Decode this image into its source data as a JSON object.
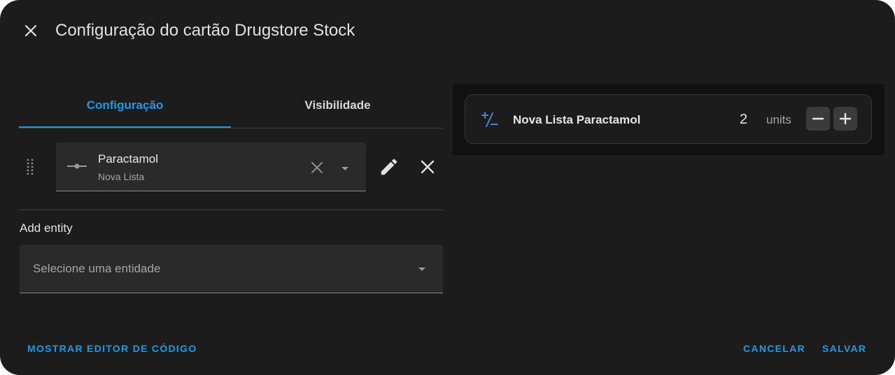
{
  "dialog": {
    "title": "Configuração do cartão Drugstore Stock"
  },
  "tabs": [
    {
      "label": "Configuração",
      "active": true
    },
    {
      "label": "Visibilidade",
      "active": false
    }
  ],
  "entity_row": {
    "name": "Paractamol",
    "secondary": "Nova Lista"
  },
  "add_entity": {
    "label": "Add entity",
    "placeholder": "Selecione uma entidade"
  },
  "preview_card": {
    "name": "Nova Lista Paractamol",
    "value": "2",
    "unit": "units"
  },
  "footer": {
    "code_editor": "MOSTRAR EDITOR DE CÓDIGO",
    "cancel": "CANCELAR",
    "save": "SALVAR"
  },
  "colors": {
    "accent": "#1f9ae8",
    "background": "#1c1c1c",
    "field": "#2a2a2a"
  },
  "icons": {
    "close": "close-icon",
    "drag": "drag-handle-icon",
    "entity": "counter-icon",
    "clear": "clear-icon",
    "dropdown": "chevron-down-icon",
    "edit": "pencil-icon",
    "remove": "close-icon",
    "card": "plus-minus-icon",
    "minus": "minus-icon",
    "plus": "plus-icon"
  }
}
